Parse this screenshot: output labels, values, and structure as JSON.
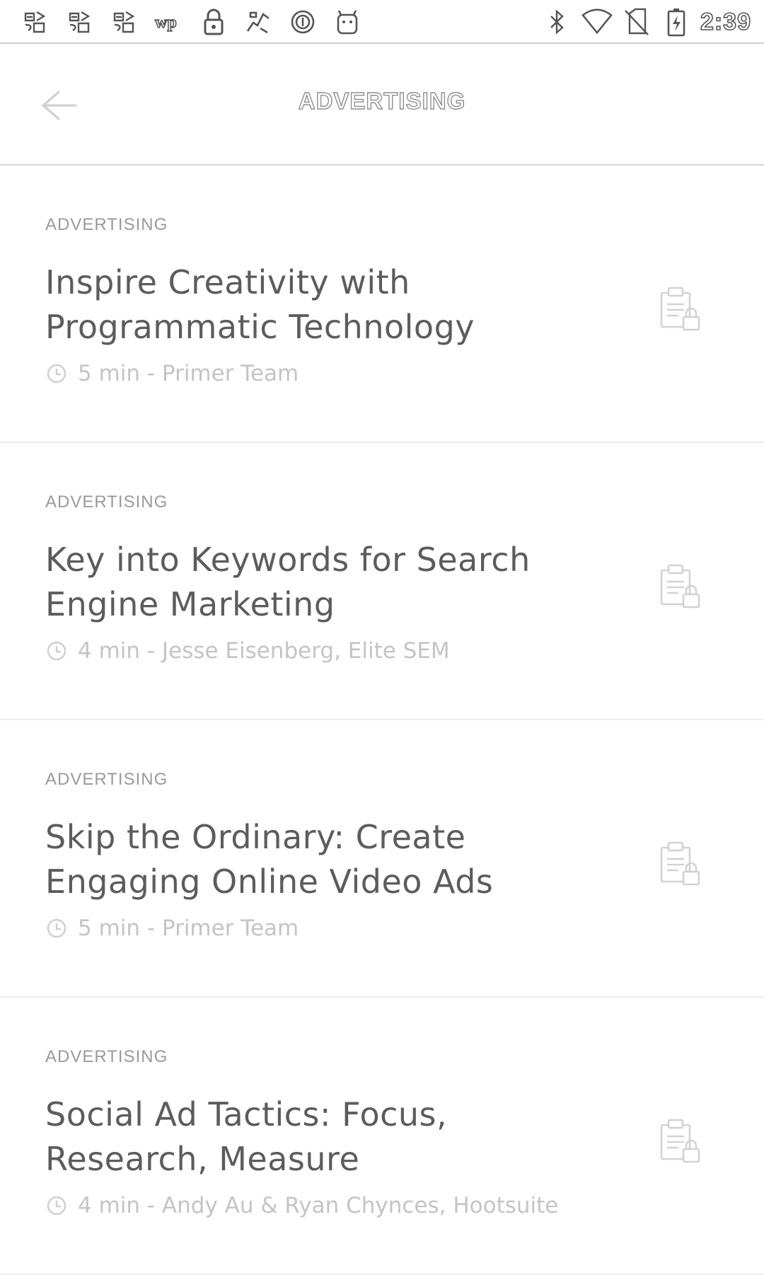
{
  "status_bar": {
    "time": "2:39",
    "left_icons": [
      "notification-icon-1",
      "notification-icon-2",
      "notification-icon-3",
      "wp-icon",
      "lock-icon",
      "fan-icon",
      "circle-icon",
      "android-icon"
    ],
    "right_icons": [
      "bluetooth-icon",
      "wifi-icon",
      "no-sim-icon",
      "battery-charging-icon"
    ]
  },
  "app_bar": {
    "title": "ADVERTISING",
    "back_icon": "arrow-left-icon"
  },
  "articles": [
    {
      "category": "ADVERTISING",
      "title": "Inspire Creativity with Programmatic Technology",
      "meta": "5 min - Primer Team",
      "icon": "locked-lesson-icon"
    },
    {
      "category": "ADVERTISING",
      "title": "Key into Keywords for Search Engine Marketing",
      "meta": "4 min - Jesse Eisenberg, Elite SEM",
      "icon": "locked-lesson-icon"
    },
    {
      "category": "ADVERTISING",
      "title": "Skip the Ordinary: Create Engaging Online Video Ads",
      "meta": "5 min - Primer Team",
      "icon": "locked-lesson-icon"
    },
    {
      "category": "ADVERTISING",
      "title": "Social Ad Tactics: Focus, Research, Measure",
      "meta": "4 min - Andy Au & Ryan Chynces, Hootsuite",
      "icon": "locked-lesson-icon"
    }
  ]
}
